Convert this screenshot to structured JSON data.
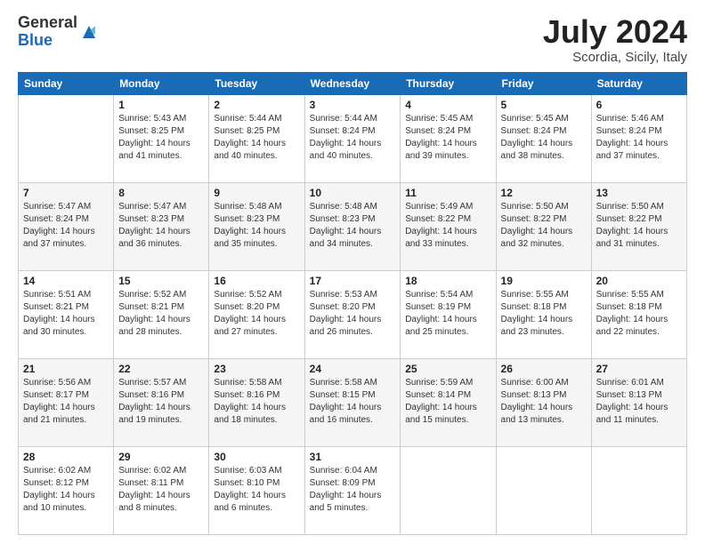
{
  "logo": {
    "general": "General",
    "blue": "Blue"
  },
  "title": "July 2024",
  "location": "Scordia, Sicily, Italy",
  "days_of_week": [
    "Sunday",
    "Monday",
    "Tuesday",
    "Wednesday",
    "Thursday",
    "Friday",
    "Saturday"
  ],
  "weeks": [
    [
      {
        "day": "",
        "sunrise": "",
        "sunset": "",
        "daylight": ""
      },
      {
        "day": "1",
        "sunrise": "5:43 AM",
        "sunset": "8:25 PM",
        "daylight": "14 hours and 41 minutes."
      },
      {
        "day": "2",
        "sunrise": "5:44 AM",
        "sunset": "8:25 PM",
        "daylight": "14 hours and 40 minutes."
      },
      {
        "day": "3",
        "sunrise": "5:44 AM",
        "sunset": "8:24 PM",
        "daylight": "14 hours and 40 minutes."
      },
      {
        "day": "4",
        "sunrise": "5:45 AM",
        "sunset": "8:24 PM",
        "daylight": "14 hours and 39 minutes."
      },
      {
        "day": "5",
        "sunrise": "5:45 AM",
        "sunset": "8:24 PM",
        "daylight": "14 hours and 38 minutes."
      },
      {
        "day": "6",
        "sunrise": "5:46 AM",
        "sunset": "8:24 PM",
        "daylight": "14 hours and 37 minutes."
      }
    ],
    [
      {
        "day": "7",
        "sunrise": "5:47 AM",
        "sunset": "8:24 PM",
        "daylight": "14 hours and 37 minutes."
      },
      {
        "day": "8",
        "sunrise": "5:47 AM",
        "sunset": "8:23 PM",
        "daylight": "14 hours and 36 minutes."
      },
      {
        "day": "9",
        "sunrise": "5:48 AM",
        "sunset": "8:23 PM",
        "daylight": "14 hours and 35 minutes."
      },
      {
        "day": "10",
        "sunrise": "5:48 AM",
        "sunset": "8:23 PM",
        "daylight": "14 hours and 34 minutes."
      },
      {
        "day": "11",
        "sunrise": "5:49 AM",
        "sunset": "8:22 PM",
        "daylight": "14 hours and 33 minutes."
      },
      {
        "day": "12",
        "sunrise": "5:50 AM",
        "sunset": "8:22 PM",
        "daylight": "14 hours and 32 minutes."
      },
      {
        "day": "13",
        "sunrise": "5:50 AM",
        "sunset": "8:22 PM",
        "daylight": "14 hours and 31 minutes."
      }
    ],
    [
      {
        "day": "14",
        "sunrise": "5:51 AM",
        "sunset": "8:21 PM",
        "daylight": "14 hours and 30 minutes."
      },
      {
        "day": "15",
        "sunrise": "5:52 AM",
        "sunset": "8:21 PM",
        "daylight": "14 hours and 28 minutes."
      },
      {
        "day": "16",
        "sunrise": "5:52 AM",
        "sunset": "8:20 PM",
        "daylight": "14 hours and 27 minutes."
      },
      {
        "day": "17",
        "sunrise": "5:53 AM",
        "sunset": "8:20 PM",
        "daylight": "14 hours and 26 minutes."
      },
      {
        "day": "18",
        "sunrise": "5:54 AM",
        "sunset": "8:19 PM",
        "daylight": "14 hours and 25 minutes."
      },
      {
        "day": "19",
        "sunrise": "5:55 AM",
        "sunset": "8:18 PM",
        "daylight": "14 hours and 23 minutes."
      },
      {
        "day": "20",
        "sunrise": "5:55 AM",
        "sunset": "8:18 PM",
        "daylight": "14 hours and 22 minutes."
      }
    ],
    [
      {
        "day": "21",
        "sunrise": "5:56 AM",
        "sunset": "8:17 PM",
        "daylight": "14 hours and 21 minutes."
      },
      {
        "day": "22",
        "sunrise": "5:57 AM",
        "sunset": "8:16 PM",
        "daylight": "14 hours and 19 minutes."
      },
      {
        "day": "23",
        "sunrise": "5:58 AM",
        "sunset": "8:16 PM",
        "daylight": "14 hours and 18 minutes."
      },
      {
        "day": "24",
        "sunrise": "5:58 AM",
        "sunset": "8:15 PM",
        "daylight": "14 hours and 16 minutes."
      },
      {
        "day": "25",
        "sunrise": "5:59 AM",
        "sunset": "8:14 PM",
        "daylight": "14 hours and 15 minutes."
      },
      {
        "day": "26",
        "sunrise": "6:00 AM",
        "sunset": "8:13 PM",
        "daylight": "14 hours and 13 minutes."
      },
      {
        "day": "27",
        "sunrise": "6:01 AM",
        "sunset": "8:13 PM",
        "daylight": "14 hours and 11 minutes."
      }
    ],
    [
      {
        "day": "28",
        "sunrise": "6:02 AM",
        "sunset": "8:12 PM",
        "daylight": "14 hours and 10 minutes."
      },
      {
        "day": "29",
        "sunrise": "6:02 AM",
        "sunset": "8:11 PM",
        "daylight": "14 hours and 8 minutes."
      },
      {
        "day": "30",
        "sunrise": "6:03 AM",
        "sunset": "8:10 PM",
        "daylight": "14 hours and 6 minutes."
      },
      {
        "day": "31",
        "sunrise": "6:04 AM",
        "sunset": "8:09 PM",
        "daylight": "14 hours and 5 minutes."
      },
      {
        "day": "",
        "sunrise": "",
        "sunset": "",
        "daylight": ""
      },
      {
        "day": "",
        "sunrise": "",
        "sunset": "",
        "daylight": ""
      },
      {
        "day": "",
        "sunrise": "",
        "sunset": "",
        "daylight": ""
      }
    ]
  ],
  "labels": {
    "sunrise": "Sunrise:",
    "sunset": "Sunset:",
    "daylight": "Daylight:"
  }
}
